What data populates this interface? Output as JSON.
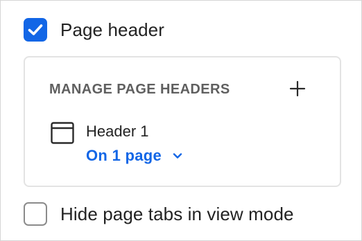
{
  "page_header_option": {
    "label": "Page header",
    "checked": true
  },
  "manage_panel": {
    "title": "MANAGE PAGE HEADERS",
    "add_icon": "plus-icon",
    "items": [
      {
        "icon": "window-icon",
        "name": "Header 1",
        "pages_label": "On 1 page",
        "dropdown_icon": "chevron-down-icon"
      }
    ]
  },
  "hide_tabs_option": {
    "label": "Hide page tabs in view mode",
    "checked": false
  },
  "colors": {
    "accent": "#1266e6",
    "panel_border": "#e3e3e3",
    "title_text": "#5f5f5f"
  }
}
